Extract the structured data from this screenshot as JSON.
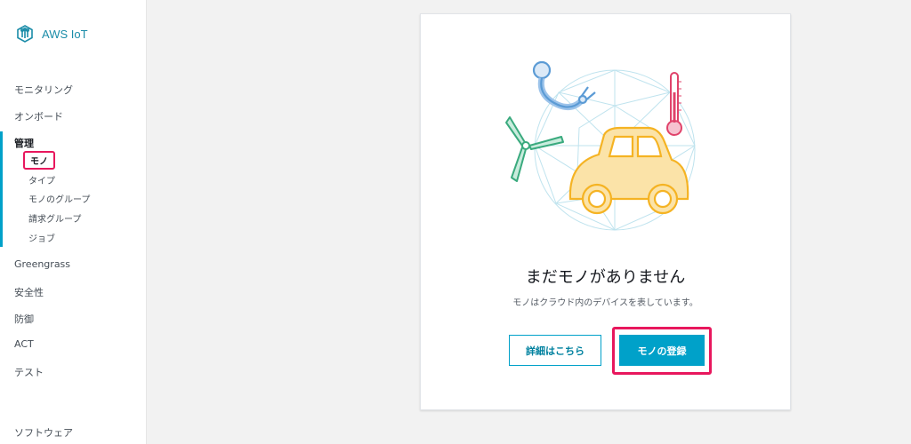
{
  "app": {
    "logo_text": "AWS IoT"
  },
  "sidebar": {
    "items": [
      {
        "label": "モニタリング"
      },
      {
        "label": "オンボード"
      },
      {
        "label": "管理"
      },
      {
        "label": "Greengrass"
      },
      {
        "label": "安全性"
      },
      {
        "label": "防御"
      },
      {
        "label": "ACT"
      },
      {
        "label": "テスト"
      },
      {
        "label": "ソフトウェア"
      }
    ],
    "manage_sub": [
      {
        "label": "モノ"
      },
      {
        "label": "タイプ"
      },
      {
        "label": "モノのグループ"
      },
      {
        "label": "請求グループ"
      },
      {
        "label": "ジョブ"
      }
    ]
  },
  "main": {
    "empty_title": "まだモノがありません",
    "empty_subtitle": "モノはクラウド内のデバイスを表しています。",
    "learn_more_label": "詳細はこちら",
    "register_label": "モノの登録"
  },
  "colors": {
    "accent": "#00a1c9",
    "highlight": "#e8175d",
    "car_fill": "#fbe3a8",
    "car_stroke": "#f5b323",
    "turbine": "#3aaa7e",
    "thermometer": "#e0436b",
    "arm": "#5b9bd5"
  }
}
